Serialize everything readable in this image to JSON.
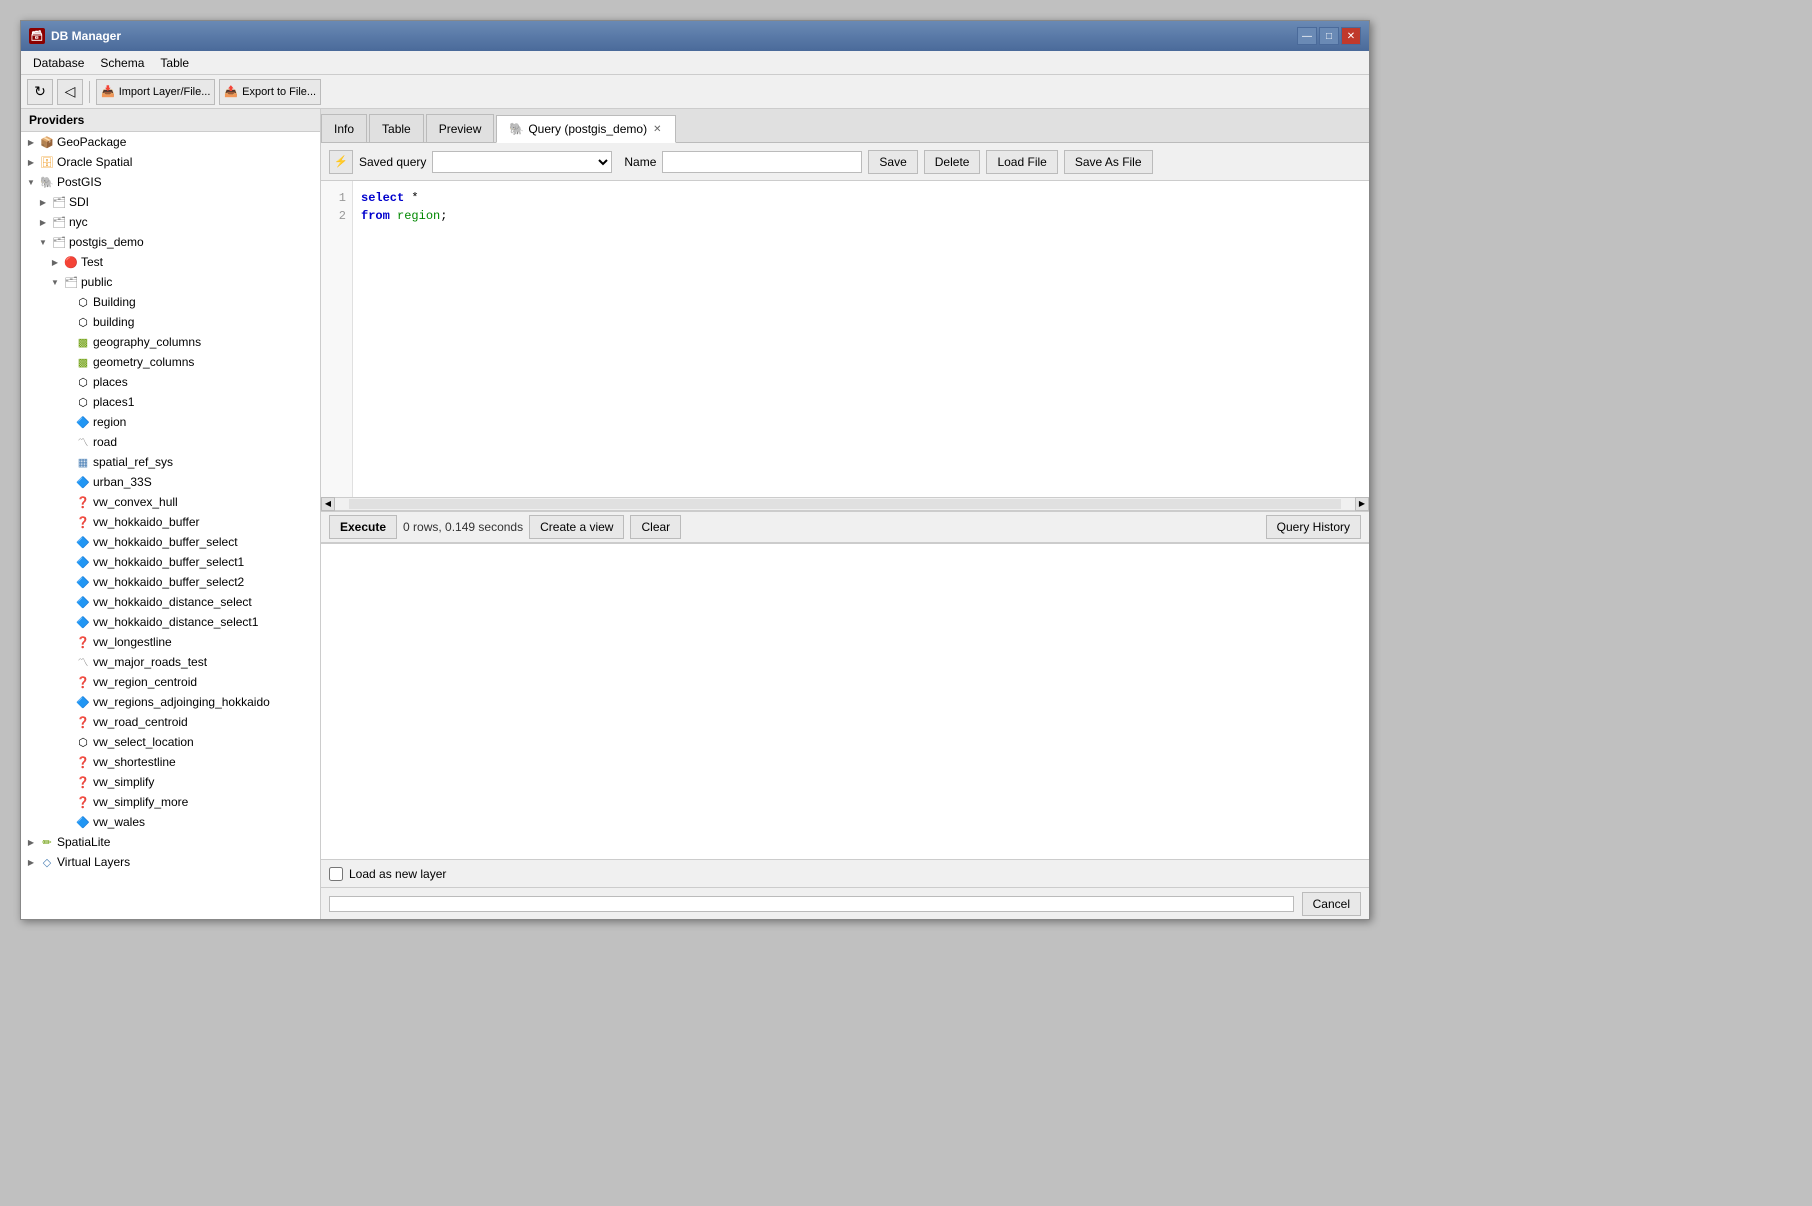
{
  "window": {
    "title": "DB Manager",
    "icon": "🗃"
  },
  "titlebar": {
    "controls": {
      "minimize": "—",
      "maximize": "□",
      "close": "✕"
    }
  },
  "menubar": {
    "items": [
      "Database",
      "Schema",
      "Table"
    ]
  },
  "toolbar": {
    "refresh_label": "↻",
    "import_label": "Import Layer/File...",
    "export_label": "Export to File..."
  },
  "sidebar": {
    "header": "Providers",
    "tree": [
      {
        "id": "geopackage",
        "label": "GeoPackage",
        "indent": 1,
        "expanded": false,
        "type": "folder"
      },
      {
        "id": "oracle",
        "label": "Oracle Spatial",
        "indent": 1,
        "expanded": false,
        "type": "folder"
      },
      {
        "id": "postgis",
        "label": "PostGIS",
        "indent": 1,
        "expanded": true,
        "type": "postgis"
      },
      {
        "id": "sdi",
        "label": "SDI",
        "indent": 2,
        "expanded": false,
        "type": "schema"
      },
      {
        "id": "nyc",
        "label": "nyc",
        "indent": 2,
        "expanded": false,
        "type": "schema"
      },
      {
        "id": "postgis_demo",
        "label": "postgis_demo",
        "indent": 2,
        "expanded": true,
        "type": "schema"
      },
      {
        "id": "test",
        "label": "Test",
        "indent": 3,
        "expanded": false,
        "type": "error"
      },
      {
        "id": "public",
        "label": "public",
        "indent": 3,
        "expanded": true,
        "type": "schema"
      },
      {
        "id": "building_cap",
        "label": "Building",
        "indent": 4,
        "expanded": false,
        "type": "table-geom"
      },
      {
        "id": "building",
        "label": "building",
        "indent": 4,
        "expanded": false,
        "type": "table-geom"
      },
      {
        "id": "geography_columns",
        "label": "geography_columns",
        "indent": 4,
        "expanded": false,
        "type": "table-geom-g"
      },
      {
        "id": "geometry_columns",
        "label": "geometry_columns",
        "indent": 4,
        "expanded": false,
        "type": "table-geom-g"
      },
      {
        "id": "places",
        "label": "places",
        "indent": 4,
        "expanded": false,
        "type": "table-geom"
      },
      {
        "id": "places1",
        "label": "places1",
        "indent": 4,
        "expanded": false,
        "type": "table-geom"
      },
      {
        "id": "region",
        "label": "region",
        "indent": 4,
        "expanded": false,
        "type": "view"
      },
      {
        "id": "road",
        "label": "road",
        "indent": 4,
        "expanded": false,
        "type": "view-line"
      },
      {
        "id": "spatial_ref_sys",
        "label": "spatial_ref_sys",
        "indent": 4,
        "expanded": false,
        "type": "table"
      },
      {
        "id": "urban_33s",
        "label": "urban_33S",
        "indent": 4,
        "expanded": false,
        "type": "view"
      },
      {
        "id": "vw_convex_hull",
        "label": "vw_convex_hull",
        "indent": 4,
        "expanded": false,
        "type": "unknown"
      },
      {
        "id": "vw_hokkaido_buffer",
        "label": "vw_hokkaido_buffer",
        "indent": 4,
        "expanded": false,
        "type": "unknown"
      },
      {
        "id": "vw_hokkaido_buffer_select",
        "label": "vw_hokkaido_buffer_select",
        "indent": 4,
        "expanded": false,
        "type": "view"
      },
      {
        "id": "vw_hokkaido_buffer_select1",
        "label": "vw_hokkaido_buffer_select1",
        "indent": 4,
        "expanded": false,
        "type": "view"
      },
      {
        "id": "vw_hokkaido_buffer_select2",
        "label": "vw_hokkaido_buffer_select2",
        "indent": 4,
        "expanded": false,
        "type": "view"
      },
      {
        "id": "vw_hokkaido_distance_select",
        "label": "vw_hokkaido_distance_select",
        "indent": 4,
        "expanded": false,
        "type": "view"
      },
      {
        "id": "vw_hokkaido_distance_select1",
        "label": "vw_hokkaido_distance_select1",
        "indent": 4,
        "expanded": false,
        "type": "view"
      },
      {
        "id": "vw_longestline",
        "label": "vw_longestline",
        "indent": 4,
        "expanded": false,
        "type": "unknown"
      },
      {
        "id": "vw_major_roads_test",
        "label": "vw_major_roads_test",
        "indent": 4,
        "expanded": false,
        "type": "view-line"
      },
      {
        "id": "vw_region_centroid",
        "label": "vw_region_centroid",
        "indent": 4,
        "expanded": false,
        "type": "unknown"
      },
      {
        "id": "vw_regions_adjoinging_hokkaido",
        "label": "vw_regions_adjoinging_hokkaido",
        "indent": 4,
        "expanded": false,
        "type": "view"
      },
      {
        "id": "vw_road_centroid",
        "label": "vw_road_centroid",
        "indent": 4,
        "expanded": false,
        "type": "unknown"
      },
      {
        "id": "vw_select_location",
        "label": "vw_select_location",
        "indent": 4,
        "expanded": false,
        "type": "table-geom"
      },
      {
        "id": "vw_shortestline",
        "label": "vw_shortestline",
        "indent": 4,
        "expanded": false,
        "type": "unknown"
      },
      {
        "id": "vw_simplify",
        "label": "vw_simplify",
        "indent": 4,
        "expanded": false,
        "type": "unknown"
      },
      {
        "id": "vw_simplify_more",
        "label": "vw_simplify_more",
        "indent": 4,
        "expanded": false,
        "type": "unknown"
      },
      {
        "id": "vw_wales",
        "label": "vw_wales",
        "indent": 4,
        "expanded": false,
        "type": "view"
      },
      {
        "id": "spatialite",
        "label": "SpatiaLite",
        "indent": 1,
        "expanded": false,
        "type": "spatialite"
      },
      {
        "id": "virtual_layers",
        "label": "Virtual Layers",
        "indent": 1,
        "expanded": false,
        "type": "virtual"
      }
    ]
  },
  "tabs": {
    "items": [
      {
        "id": "info",
        "label": "Info",
        "active": false,
        "closable": false
      },
      {
        "id": "table",
        "label": "Table",
        "active": false,
        "closable": false
      },
      {
        "id": "preview",
        "label": "Preview",
        "active": false,
        "closable": false
      },
      {
        "id": "query",
        "label": "Query (postgis_demo)",
        "active": true,
        "closable": true
      }
    ]
  },
  "query": {
    "toolbar": {
      "icon_label": "⚡",
      "saved_query_label": "Saved query",
      "saved_query_placeholder": "",
      "name_label": "Name",
      "name_value": "",
      "save_label": "Save",
      "delete_label": "Delete",
      "load_file_label": "Load File",
      "save_as_file_label": "Save As File"
    },
    "code": {
      "lines": [
        {
          "num": "1",
          "content": "select *"
        },
        {
          "num": "2",
          "content": "from region;"
        }
      ],
      "line1_keyword": "select",
      "line1_rest": " *",
      "line2_keyword": "from",
      "line2_table": " region",
      "line2_end": ";"
    },
    "execute_bar": {
      "execute_label": "Execute",
      "status": "0 rows, 0.149 seconds",
      "create_view_label": "Create a view",
      "clear_label": "Clear",
      "query_history_label": "Query History"
    },
    "results": {
      "content": ""
    },
    "load_layer": {
      "checkbox_label": "Load as new layer",
      "checked": false
    }
  },
  "statusbar": {
    "progress": "",
    "cancel_label": "Cancel"
  }
}
